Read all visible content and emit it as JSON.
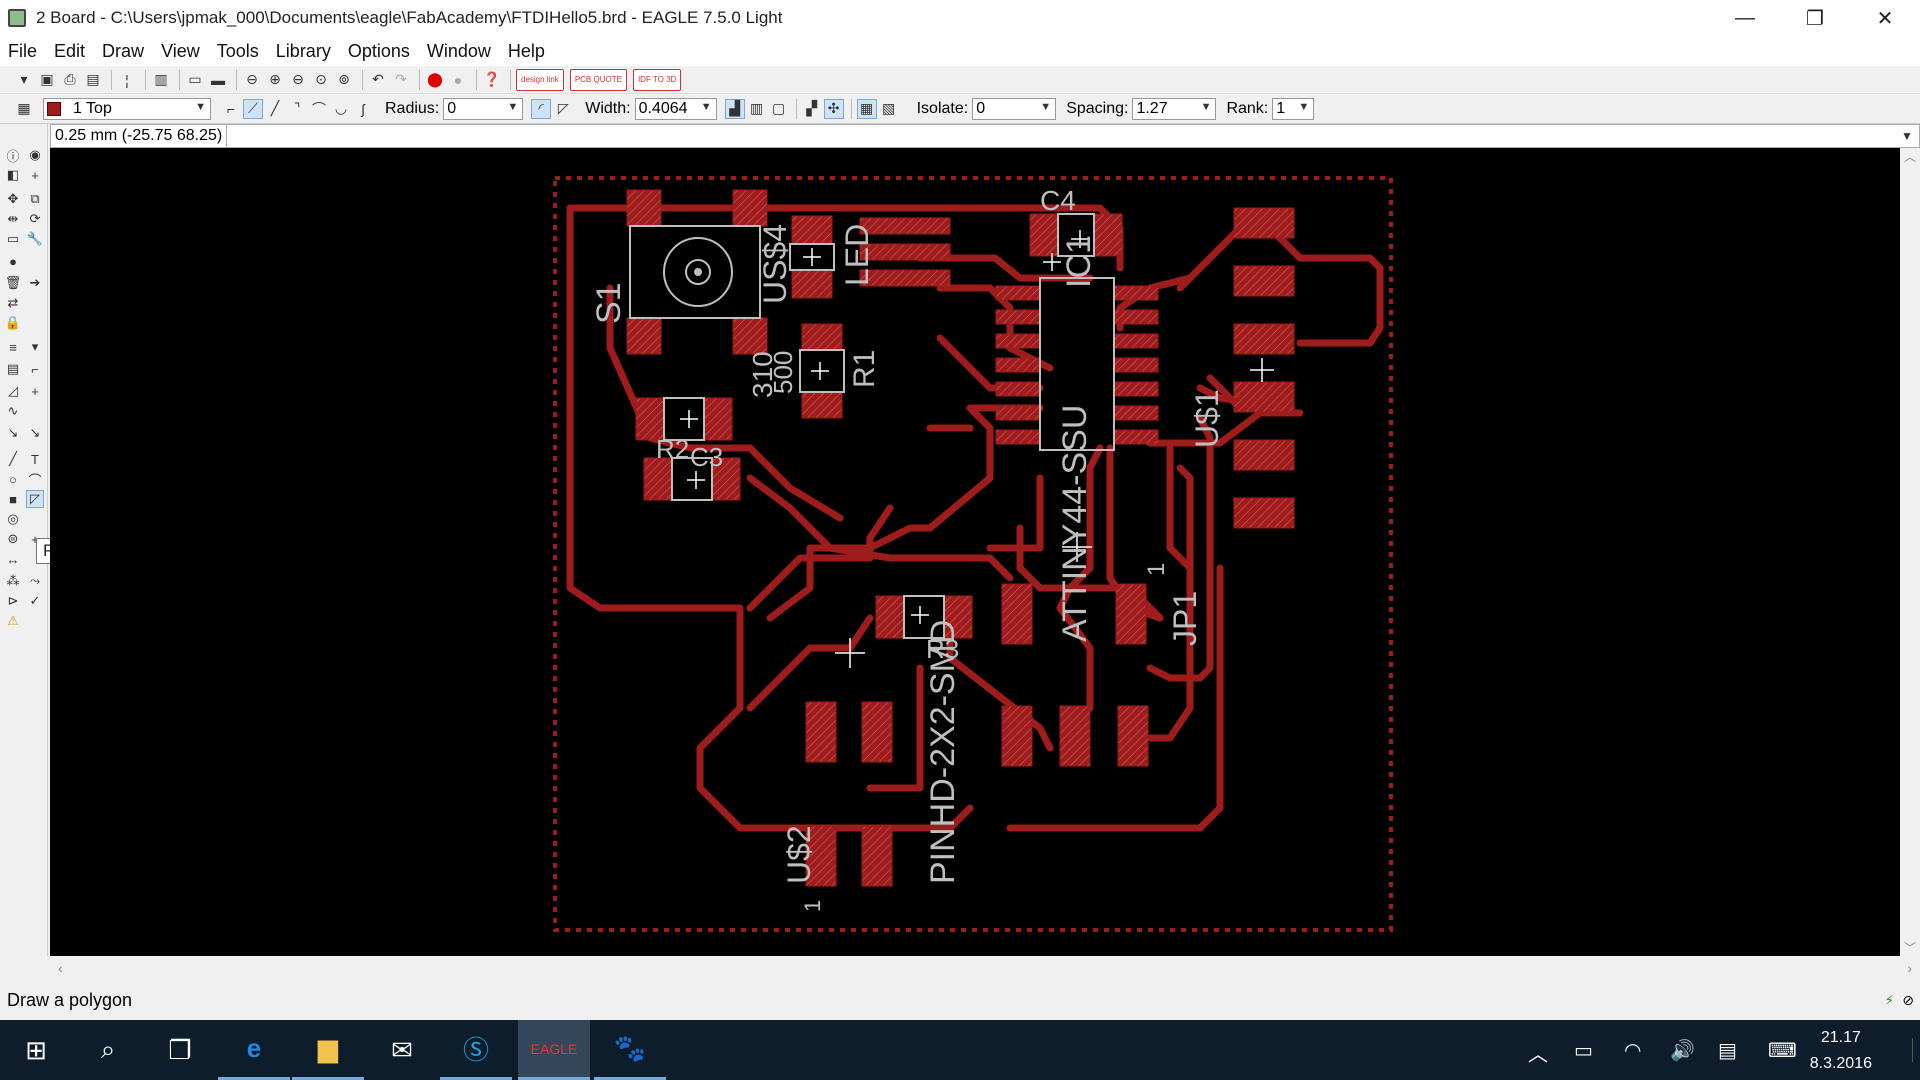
{
  "window": {
    "title": "2 Board - C:\\Users\\jpmak_000\\Documents\\eagle\\FabAcademy\\FTDIHello5.brd - EAGLE 7.5.0 Light",
    "controls": [
      "—",
      "❐",
      "✕"
    ]
  },
  "menu": [
    "File",
    "Edit",
    "Draw",
    "View",
    "Tools",
    "Library",
    "Options",
    "Window",
    "Help"
  ],
  "toolbar": {
    "brand_buttons": [
      "design link",
      "PCB QUOTE",
      "IDF TO 3D"
    ]
  },
  "parameters": {
    "layer": "1 Top",
    "layer_color": "#9b1c1c",
    "radius_label": "Radius:",
    "radius_value": "0",
    "width_label": "Width:",
    "width_value": "0.4064",
    "isolate_label": "Isolate:",
    "isolate_value": "0",
    "spacing_label": "Spacing:",
    "spacing_value": "1.27",
    "rank_label": "Rank:",
    "rank_value": "1"
  },
  "command": {
    "coordinates": "0.25 mm (-25.75 68.25)",
    "input_value": ""
  },
  "tooltip": "Polygon",
  "status": "Draw a polygon",
  "clock": {
    "time": "21.17",
    "date": "8.3.2016"
  },
  "board": {
    "trace_color": "#9e1c1c",
    "silk_color": "#bfbfbf",
    "labels": [
      {
        "text": "C4"
      },
      {
        "text": "IC1"
      },
      {
        "text": "S1"
      },
      {
        "text": "US$4"
      },
      {
        "text": "LED"
      },
      {
        "text": "R1"
      },
      {
        "text": "500"
      },
      {
        "text": "R2"
      },
      {
        "text": "C3"
      },
      {
        "text": "U$1"
      },
      {
        "text": "ATTINY44-SSU"
      },
      {
        "text": "1"
      },
      {
        "text": "JP1"
      },
      {
        "text": "R3"
      },
      {
        "text": "PINHD-2X2-SMD"
      },
      {
        "text": "U$2"
      },
      {
        "text": "1"
      },
      {
        "text": "310"
      }
    ]
  }
}
